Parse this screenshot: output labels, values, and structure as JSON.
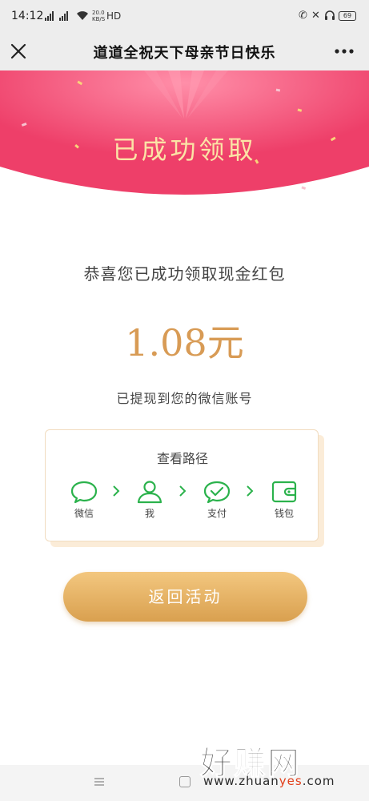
{
  "status_bar": {
    "time": "14:12",
    "network_speed": "20.0\nKB/S",
    "network_type": "HD",
    "battery": "69"
  },
  "nav": {
    "title": "道道全祝天下母亲节日快乐",
    "close_icon": "close-icon",
    "more_icon": "more-icon"
  },
  "banner": {
    "title": "已成功领取",
    "background_color": "#f0486f"
  },
  "result": {
    "congrats": "恭喜您已成功领取现金红包",
    "amount": "1.08元",
    "withdrawn_note": "已提现到您的微信账号"
  },
  "path_card": {
    "title": "查看路径",
    "steps": [
      {
        "label": "微信",
        "icon": "chat-bubble-icon"
      },
      {
        "label": "我",
        "icon": "person-icon"
      },
      {
        "label": "支付",
        "icon": "payment-check-icon"
      },
      {
        "label": "钱包",
        "icon": "wallet-icon"
      }
    ],
    "icon_color": "#2bb24c"
  },
  "actions": {
    "back_label": "返回活动"
  },
  "watermark": {
    "brand": "好赚网",
    "url_prefix": "www.zhuan",
    "url_accent": "yes",
    "url_suffix": ".com"
  }
}
